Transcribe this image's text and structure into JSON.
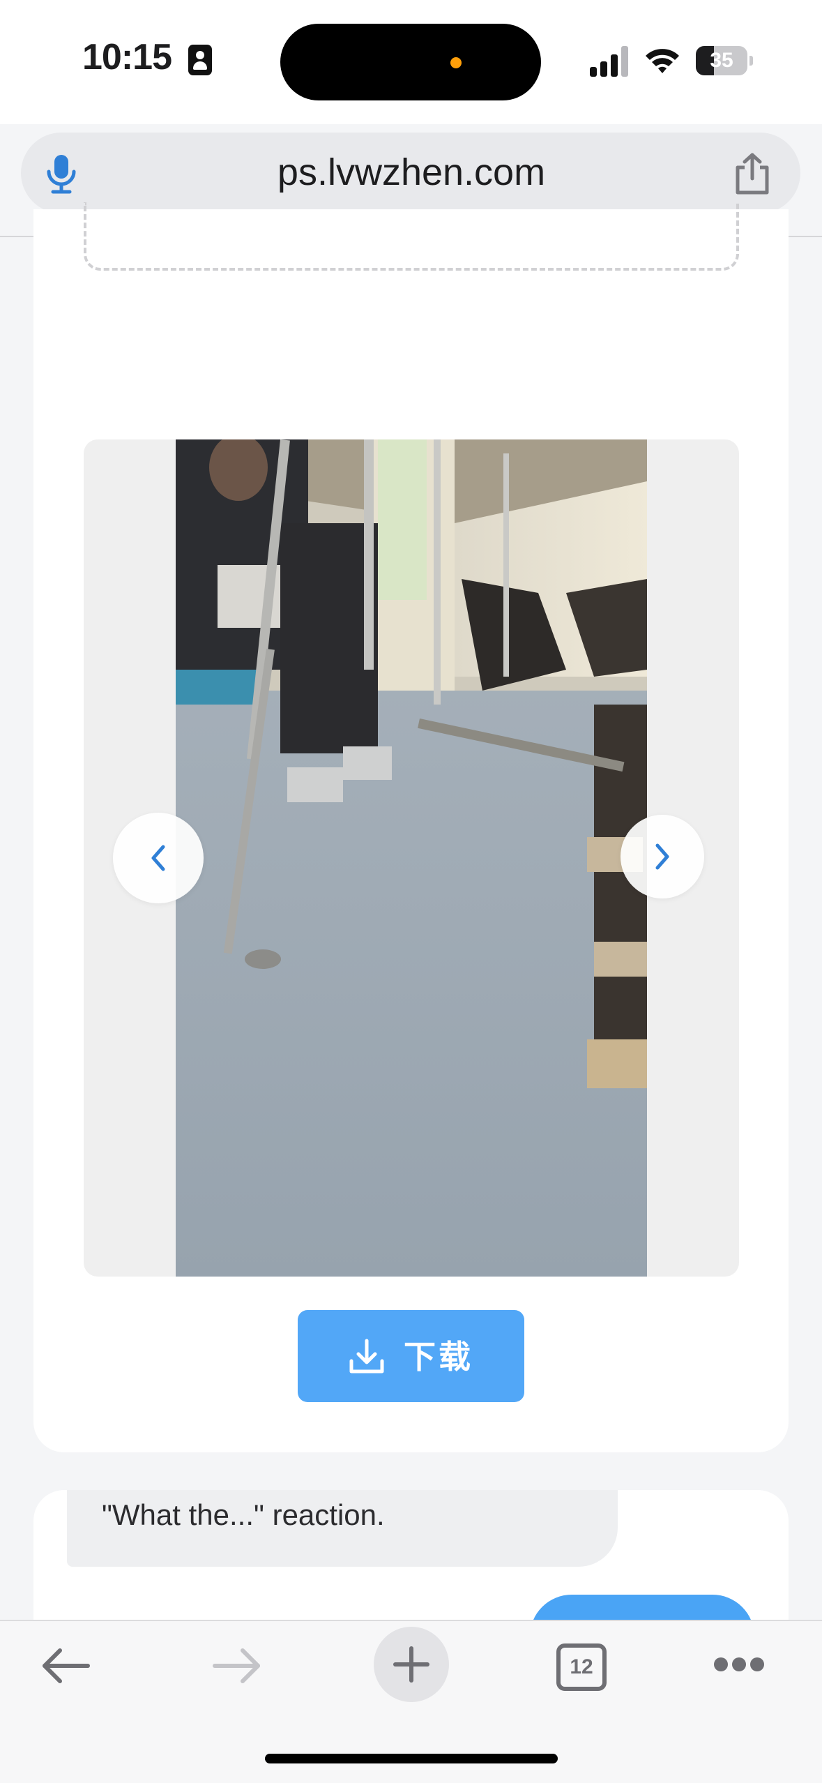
{
  "status_bar": {
    "time": "10:15",
    "battery_level": "35",
    "battery_fraction": 0.35,
    "icons": [
      "focus-icon",
      "signal-icon",
      "wifi-icon",
      "battery-icon"
    ]
  },
  "browser": {
    "url": "ps.lvwzhen.com",
    "mic_icon": "microphone-icon",
    "share_icon": "share-icon",
    "tab_count": "12",
    "bottom_icons": [
      "back-arrow-icon",
      "forward-arrow-icon",
      "plus-icon",
      "tabs-icon",
      "more-icon"
    ]
  },
  "preview": {
    "prev_icon": "chevron-left-icon",
    "next_icon": "chevron-right-icon",
    "download_label": "下载",
    "download_icon": "download-icon"
  },
  "chat": {
    "message": "\"What the...\" reaction."
  },
  "colors": {
    "accent": "#52a7f7",
    "page_bg": "#f4f5f7",
    "chevron": "#2f7fd6"
  }
}
